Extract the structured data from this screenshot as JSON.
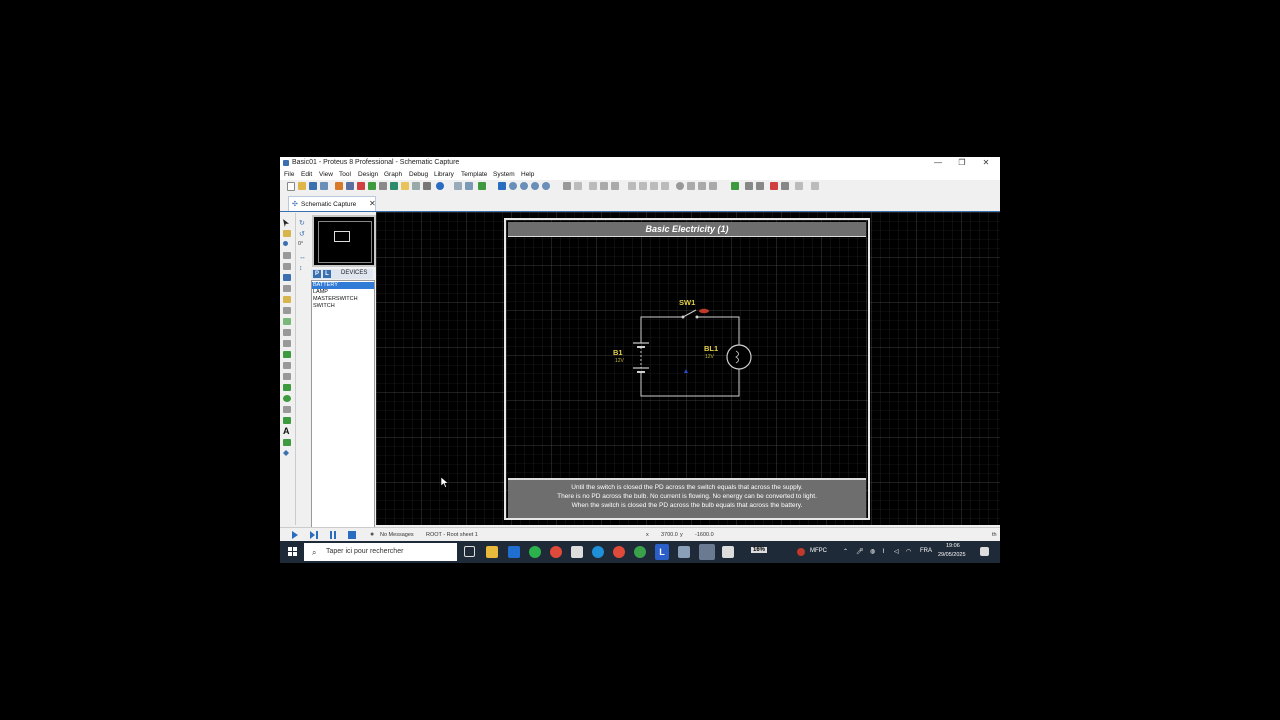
{
  "window": {
    "title": "Basic01 - Proteus 8 Professional - Schematic Capture",
    "minimize_glyph": "—",
    "restore_glyph": "❐",
    "close_glyph": "✕"
  },
  "menu": [
    "File",
    "Edit",
    "View",
    "Tool",
    "Design",
    "Graph",
    "Debug",
    "Library",
    "Template",
    "System",
    "Help"
  ],
  "tabs": [
    {
      "label": "Schematic Capture",
      "close": "✕"
    }
  ],
  "devices": {
    "p_label": "P",
    "l_label": "L",
    "header": "DEVICES",
    "items": [
      "BATTERY",
      "LAMP",
      "MASTERSWITCH",
      "SWITCH"
    ],
    "selected": "BATTERY"
  },
  "side_rotation": "0°",
  "schematic": {
    "header": "Basic Electricity (1)",
    "components": {
      "switch": {
        "ref": "SW1"
      },
      "battery": {
        "ref": "B1",
        "value": "12V"
      },
      "lamp": {
        "ref": "BL1",
        "value": "12V"
      }
    },
    "notes": [
      "Until the switch is closed the PD across the switch equals that across the supply.",
      "There is no PD across the bulb.  No current is flowing.  No energy can be converted to light.",
      "When the switch is closed the PD across the bulb equals that across the battery."
    ]
  },
  "status": {
    "messages": "No Messages",
    "sheet": "ROOT - Root sheet 1",
    "x_label": "x",
    "x_value": "3700.0",
    "y_label": "y",
    "y_value": "-1600.0",
    "units": "th"
  },
  "taskbar": {
    "search_placeholder": "Taper ici pour rechercher",
    "battery_pct": "16%",
    "user": "MFPC",
    "language": "FRA",
    "time": "19:06",
    "date": "29/05/2025"
  },
  "colors": {
    "accent": "#3a6fb0",
    "selection": "#2f7bd6",
    "label_yellow": "#e3d24a",
    "wire": "#cfcfcf",
    "switch_red": "#c0392b"
  }
}
